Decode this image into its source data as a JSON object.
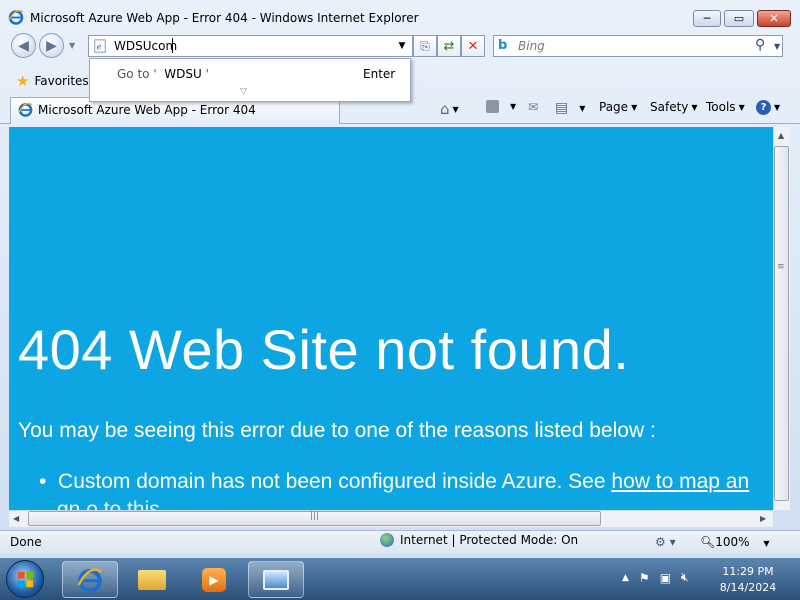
{
  "window": {
    "title": "Microsoft Azure Web App - Error 404 - Windows Internet Explorer",
    "minimize": "─",
    "maximize": "▭",
    "close": "✕"
  },
  "address": {
    "value": "WDSUcom",
    "suggestion_prefix": "Go to '",
    "suggestion_value": "WDSU",
    "suggestion_suffix": "'",
    "suggestion_key": "Enter"
  },
  "search": {
    "placeholder": "Bing"
  },
  "favorites": {
    "label": "Favorites"
  },
  "tab": {
    "label": "Microsoft Azure Web App - Error 404"
  },
  "toolbar": {
    "page": "Page",
    "safety": "Safety",
    "tools": "Tools"
  },
  "content": {
    "heading": "404 Web Site not found.",
    "reason": "You may be seeing this error due to one of the reasons listed below :",
    "bullet_text": "Custom domain has not been configured inside Azure. See",
    "bullet_link": "how to map an",
    "bullet_continued": "gn o to this"
  },
  "status": {
    "left": "Done",
    "zone": "Internet | Protected Mode: On",
    "zoom": "100%"
  },
  "taskbar": {
    "time": "11:29 PM",
    "date": "8/14/2024"
  },
  "colors": {
    "page_background": "#0ea5e3",
    "page_text": "#ffffff"
  }
}
